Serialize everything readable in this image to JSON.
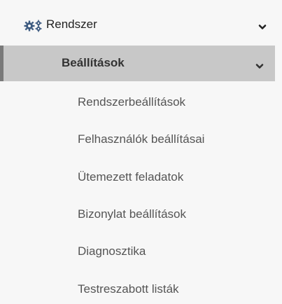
{
  "menu": {
    "level1": {
      "label": "Rendszer",
      "icon": "cogs-icon",
      "chevron": "chevron-down-icon"
    },
    "level2": {
      "label": "Beállítások",
      "chevron": "chevron-down-icon"
    },
    "items": [
      {
        "label": "Rendszerbeállítások"
      },
      {
        "label": "Felhasználók beállításai"
      },
      {
        "label": "Ütemezett feladatok"
      },
      {
        "label": "Bizonylat beállítások"
      },
      {
        "label": "Diagnosztika"
      },
      {
        "label": "Testreszabott listák"
      }
    ]
  },
  "colors": {
    "background": "#f7f7f7",
    "active_bg": "#c8c8c8",
    "active_border": "#7a7a7a",
    "icon": "#3d5a80"
  }
}
